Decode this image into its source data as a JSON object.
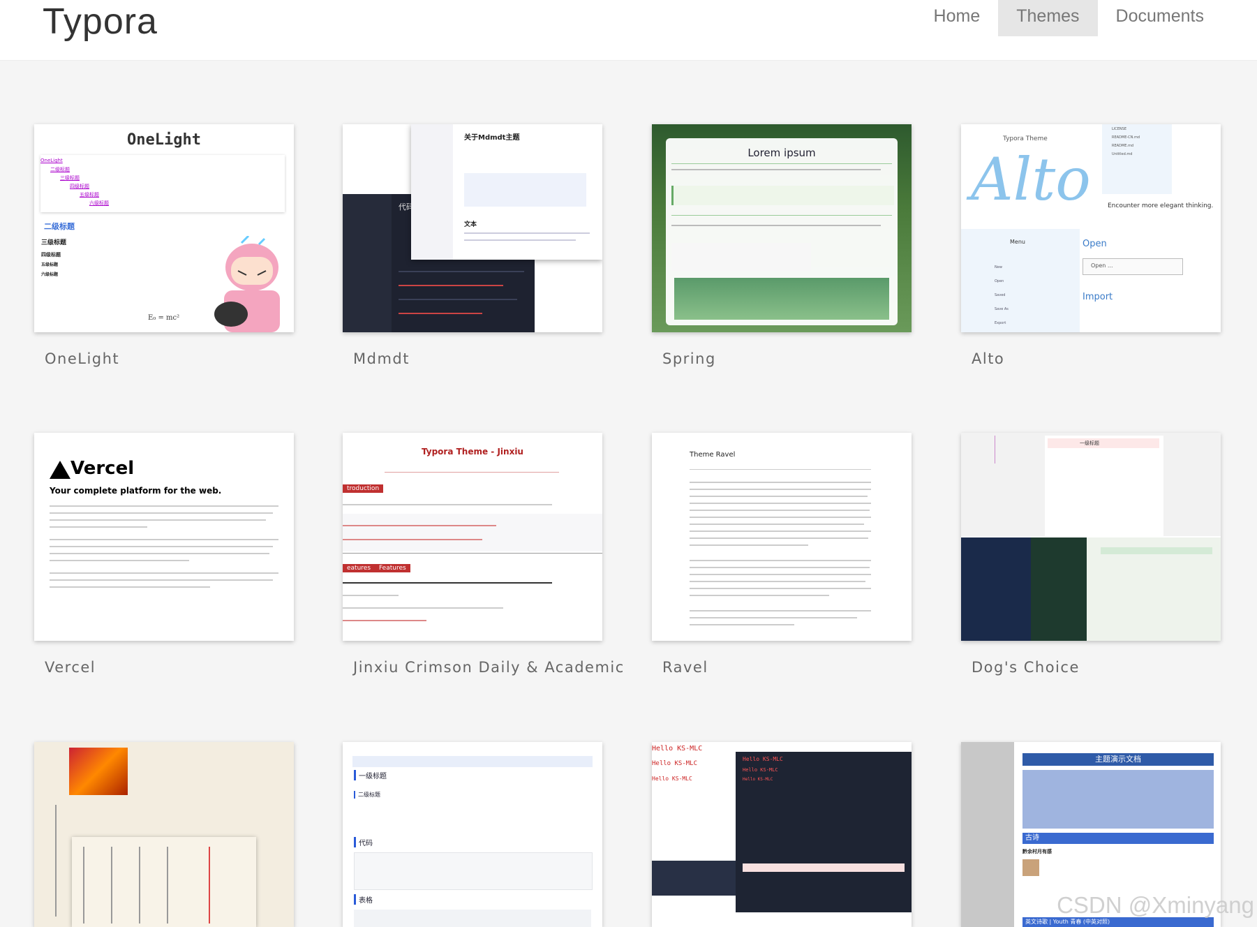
{
  "header": {
    "logo": "Typora",
    "nav": [
      {
        "label": "Home"
      },
      {
        "label": "Themes",
        "active": true
      },
      {
        "label": "Documents"
      }
    ]
  },
  "themes": [
    {
      "title": "OneLight"
    },
    {
      "title": "Mdmdt"
    },
    {
      "title": "Spring"
    },
    {
      "title": "Alto"
    },
    {
      "title": "Vercel"
    },
    {
      "title": "Jinxiu Crimson Daily & Academic"
    },
    {
      "title": "Ravel"
    },
    {
      "title": "Dog's Choice"
    }
  ],
  "thumbs": {
    "onelight": {
      "heading": "OneLight",
      "toc": "OneLight",
      "h2": "二级标题",
      "h3": "三级标题",
      "h4": "四级标题",
      "h5": "五级标题",
      "h6": "六级标题",
      "formula": "E₀ = mc²"
    },
    "mdmdt": {
      "title": "关于Mdmdt主题",
      "section": "文本",
      "code_heading": "代码"
    },
    "spring": {
      "title": "Lorem ipsum"
    },
    "alto": {
      "caption": "Typora Theme",
      "script": "Alto",
      "tagline": "Encounter more elegant thinking.",
      "menu": "Menu",
      "open": "Open",
      "open_field": "Open ...",
      "import": "Import",
      "menu_items": [
        "New",
        "Open",
        "Saved",
        "Save As",
        "Export"
      ],
      "files": [
        "LICENSE",
        "README-CN.md",
        "README.md",
        "Untitled.md"
      ]
    },
    "vercel": {
      "logo": "Vercel",
      "headline": "Your complete platform for the web."
    },
    "jinxiu": {
      "title": "Typora Theme - Jinxiu",
      "tag1": "troduction",
      "tag2": "eatures",
      "tag3": "Features"
    },
    "ravel": {
      "title": "Theme Ravel"
    },
    "dogs": {
      "heading": "一级标题"
    },
    "bottom2": {
      "h1": "一级标题",
      "h2": "二级标题",
      "code": "代码",
      "table": "表格"
    },
    "bottom3": {
      "line": "Hello KS-MLC"
    },
    "bottom4": {
      "title": "主题演示文档",
      "poem": "古诗",
      "poem_title": "黔余村月有感",
      "footer": "英文诗歌 | Youth 青春 (中英对照)"
    }
  },
  "watermark": "CSDN @Xminyang",
  "colors": {
    "header_bg": "#ffffff",
    "page_bg": "#f5f5f5",
    "nav_active_bg": "#e6e6e6",
    "text": "#666666"
  }
}
